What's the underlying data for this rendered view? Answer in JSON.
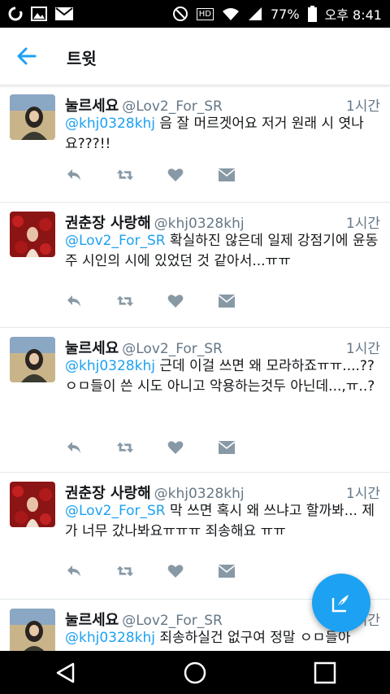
{
  "status_bar": {
    "battery": "77%",
    "time": "오후 8:41",
    "hd": "HD"
  },
  "header": {
    "title": "트윗"
  },
  "tweets": [
    {
      "display_name": "눌르세요",
      "handle": "@Lov2_For_SR",
      "time": "1시간",
      "mention": "@khj0328khj",
      "text": " 음 잘 머르겟어요 저거 원래 시 엿나요???!!"
    },
    {
      "display_name": "권춘장 사랑해",
      "handle": "@khj0328khj",
      "time": "1시간",
      "mention": "@Lov2_For_SR",
      "text": " 확실하진 않은데 일제 강점기에 윤동주 시인의 시에 있었던 것 같아서...ㅠㅠ"
    },
    {
      "display_name": "눌르세요",
      "handle": "@Lov2_For_SR",
      "time": "1시간",
      "mention": "@khj0328khj",
      "text": " 근데 이걸 쓰면 왜 모라하죠ㅠㅠ....?? ㅇㅁ들이 쓴 시도 아니고 악용하는것두 아닌데...,ㅠ..?"
    },
    {
      "display_name": "권춘장 사랑해",
      "handle": "@khj0328khj",
      "time": "1시간",
      "mention": "@Lov2_For_SR",
      "text": " 막 쓰면 혹시 왜 쓰냐고 할까봐... 제가 너무 갔나봐요ㅠㅠㅠ 죄송해요 ㅠㅠ"
    },
    {
      "display_name": "눌르세요",
      "handle": "@Lov2_For_SR",
      "time": "1시간",
      "mention": "@khj0328khj",
      "text": " 죄송하실건 없구여 정말 ㅇㅁ들아"
    }
  ],
  "icons": {
    "reply": "reply-icon",
    "retweet": "retweet-icon",
    "like": "heart-icon",
    "dm": "envelope-icon",
    "compose": "compose-icon"
  },
  "colors": {
    "accent": "#1da1f2",
    "secondary_text": "#657786",
    "action_icon": "#8899a6"
  }
}
